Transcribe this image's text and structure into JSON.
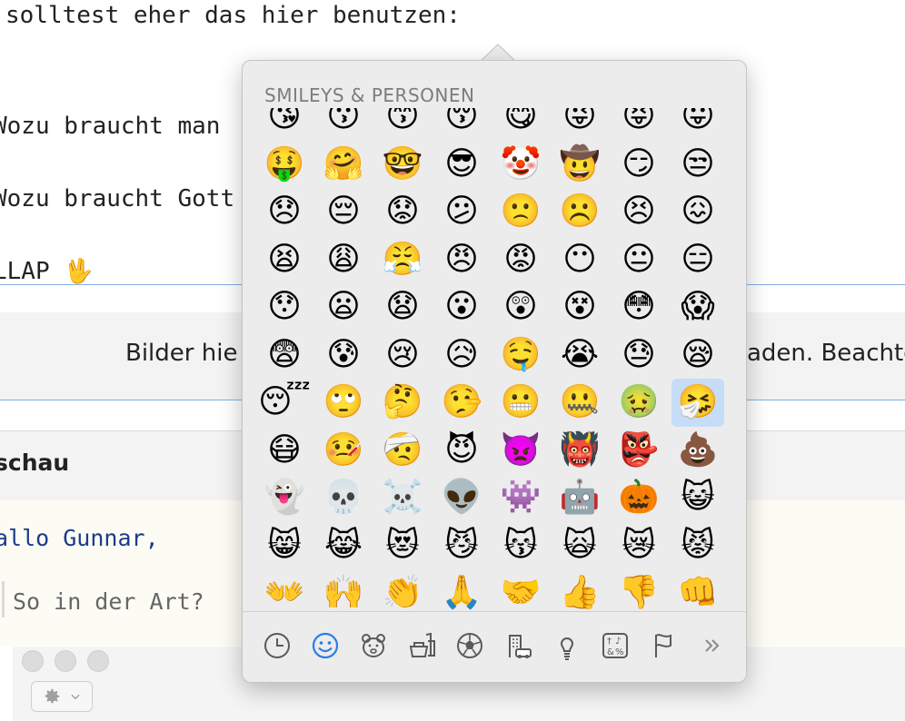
{
  "editor": {
    "line1": "solltest eher das hier benutzen:",
    "line2": "Wozu braucht man",
    "line3": "Wozu braucht Gott",
    "line4": "LLAP 🖖"
  },
  "upload": {
    "text_left": "Bilder hie",
    "text_right": "aden. Beachte"
  },
  "preview": {
    "title": "schau",
    "greeting": "allo Gunnar,",
    "quote": "So in der Art?"
  },
  "emoji_picker": {
    "section_title": "SMILEYS & PERSONEN",
    "selected_index": 55,
    "emojis": [
      "😘",
      "😗",
      "😙",
      "😚",
      "😋",
      "😜",
      "😝",
      "😛",
      "🤑",
      "🤗",
      "🤓",
      "😎",
      "🤡",
      "🤠",
      "😏",
      "😒",
      "😞",
      "😔",
      "😟",
      "😕",
      "🙁",
      "☹️",
      "😣",
      "😖",
      "😫",
      "😩",
      "😤",
      "😠",
      "😡",
      "😶",
      "😐",
      "😑",
      "😯",
      "😦",
      "😧",
      "😮",
      "😲",
      "😵",
      "😳",
      "😱",
      "😨",
      "😰",
      "😢",
      "😥",
      "🤤",
      "😭",
      "😓",
      "😪",
      "😴",
      "🙄",
      "🤔",
      "🤥",
      "😬",
      "🤐",
      "🤢",
      "🤧",
      "😷",
      "🤒",
      "🤕",
      "😈",
      "👿",
      "👹",
      "👺",
      "💩",
      "👻",
      "💀",
      "☠️",
      "👽",
      "👾",
      "🤖",
      "🎃",
      "😺",
      "😸",
      "😹",
      "😻",
      "😼",
      "😽",
      "🙀",
      "😿",
      "😾",
      "👐",
      "🙌",
      "👏",
      "🙏",
      "🤝",
      "👍",
      "👎",
      "👊"
    ],
    "categories": [
      {
        "name": "recent-icon"
      },
      {
        "name": "smileys-icon",
        "active": true
      },
      {
        "name": "animals-icon"
      },
      {
        "name": "food-icon"
      },
      {
        "name": "activity-icon"
      },
      {
        "name": "travel-icon"
      },
      {
        "name": "objects-icon"
      },
      {
        "name": "symbols-icon"
      },
      {
        "name": "flags-icon"
      },
      {
        "name": "more-icon"
      }
    ],
    "active_color": "#2a7ee6",
    "icon_color": "#5a5a5a"
  }
}
